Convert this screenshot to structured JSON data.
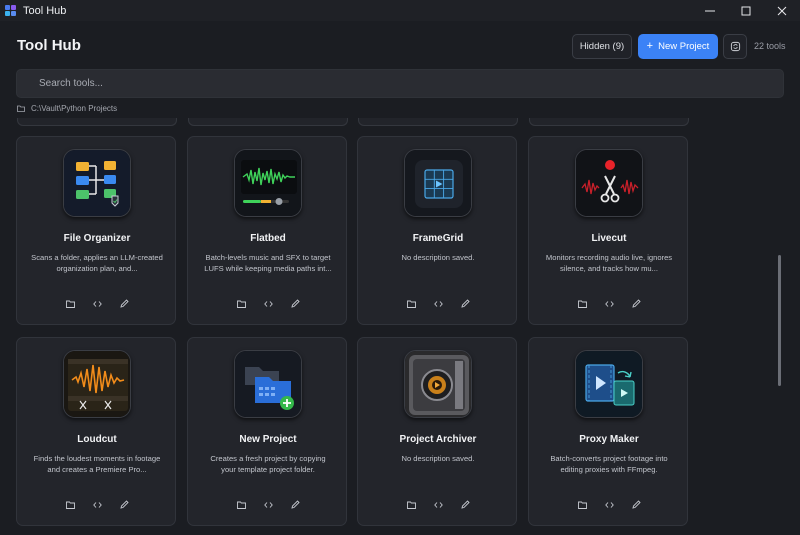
{
  "window": {
    "title": "Tool Hub"
  },
  "header": {
    "title": "Tool Hub",
    "hidden_label": "Hidden (9)",
    "new_project_label": "New Project",
    "tool_count": "22 tools"
  },
  "search": {
    "placeholder": "Search tools..."
  },
  "path": "C:\\Vault\\Python Projects",
  "card_actions": {
    "folder": "folder-icon",
    "code": "code-icon",
    "edit": "pencil-icon"
  },
  "cards": [
    {
      "name": "File Organizer",
      "description": "Scans a folder, applies an LLM-created organization plan, and...",
      "icon": "file-organizer-icon"
    },
    {
      "name": "Flatbed",
      "description": "Batch-levels music and SFX to target LUFS while keeping media paths int...",
      "icon": "flatbed-waveform-icon"
    },
    {
      "name": "FrameGrid",
      "description": "No description saved.",
      "icon": "framegrid-film-icon"
    },
    {
      "name": "Livecut",
      "description": "Monitors recording audio live, ignores silence, and tracks how mu...",
      "icon": "livecut-scissors-icon"
    },
    {
      "name": "Loudcut",
      "description": "Finds the loudest moments in footage and creates a Premiere Pro...",
      "icon": "loudcut-waveform-icon"
    },
    {
      "name": "New Project",
      "description": "Creates a fresh project by copying your template project folder.",
      "icon": "new-project-folder-icon"
    },
    {
      "name": "Project Archiver",
      "description": "No description saved.",
      "icon": "project-archiver-vault-icon"
    },
    {
      "name": "Proxy Maker",
      "description": "Batch-converts project footage into editing proxies with FFmpeg.",
      "icon": "proxy-maker-video-icon"
    }
  ],
  "colors": {
    "accent": "#3b82f6",
    "background": "#1b1d22",
    "card": "#23252b"
  }
}
